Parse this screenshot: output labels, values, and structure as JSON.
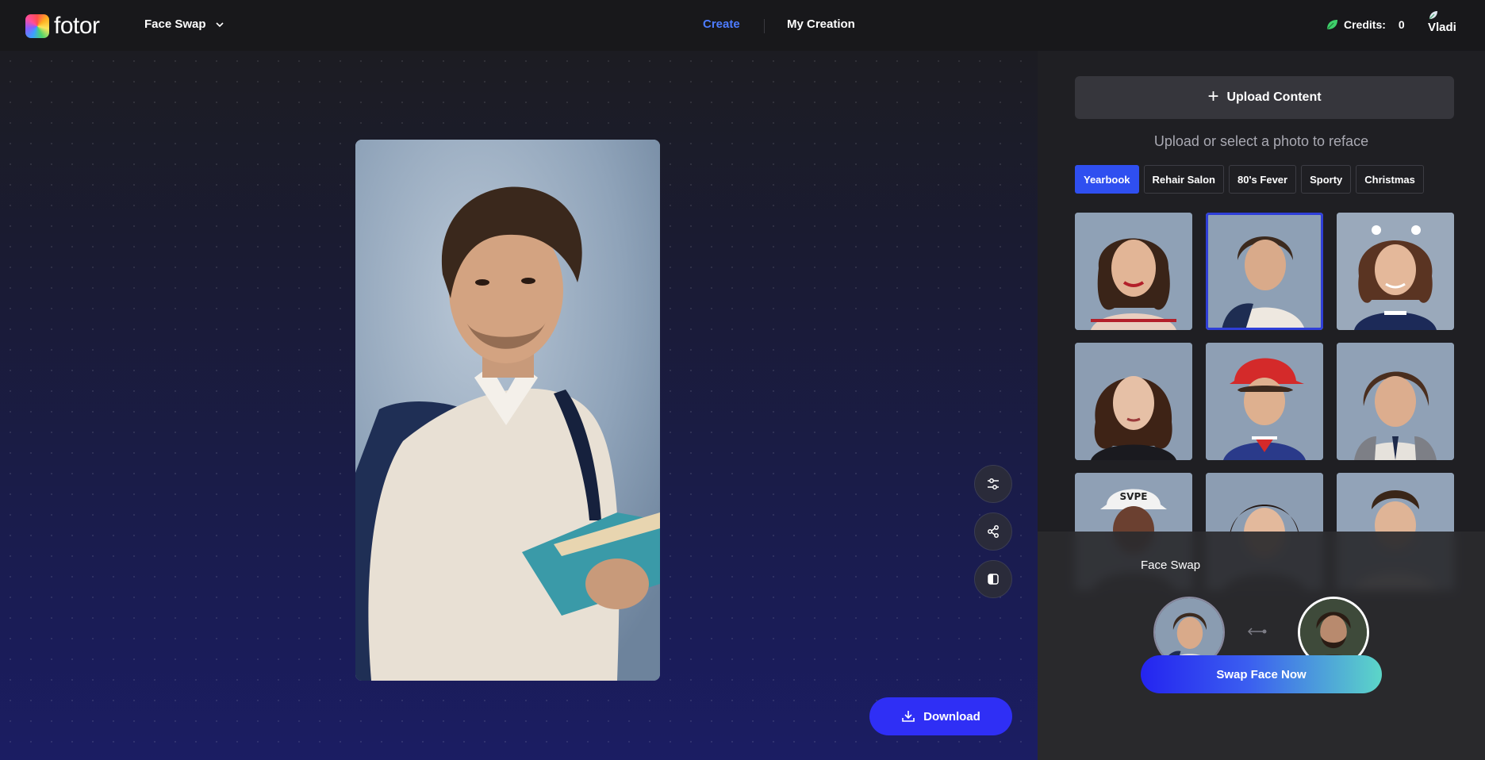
{
  "brand": {
    "name": "fotor"
  },
  "header": {
    "tool": "Face Swap",
    "nav": {
      "create": "Create",
      "my_creation": "My Creation"
    },
    "credits_label": "Credits:",
    "credits_value": "0",
    "user_name": "Vladi"
  },
  "canvas": {
    "download_label": "Download",
    "tools": [
      "adjust-icon",
      "share-icon",
      "compare-icon"
    ]
  },
  "panel": {
    "upload_label": "Upload Content",
    "hint": "Upload or select a photo to reface",
    "tabs": [
      {
        "label": "Yearbook",
        "active": true
      },
      {
        "label": "Rehair Salon",
        "active": false
      },
      {
        "label": "80's Fever",
        "active": false
      },
      {
        "label": "Sporty",
        "active": false
      },
      {
        "label": "Christmas",
        "active": false
      }
    ],
    "thumbnails_selected_index": 1
  },
  "swap_card": {
    "title": "Face Swap",
    "button_label": "Swap Face Now"
  },
  "colors": {
    "accent_blue": "#2f2ff5",
    "active_tab": "#2f4ff0",
    "nav_active": "#4d7cff",
    "panel_bg": "#1f1f23"
  }
}
